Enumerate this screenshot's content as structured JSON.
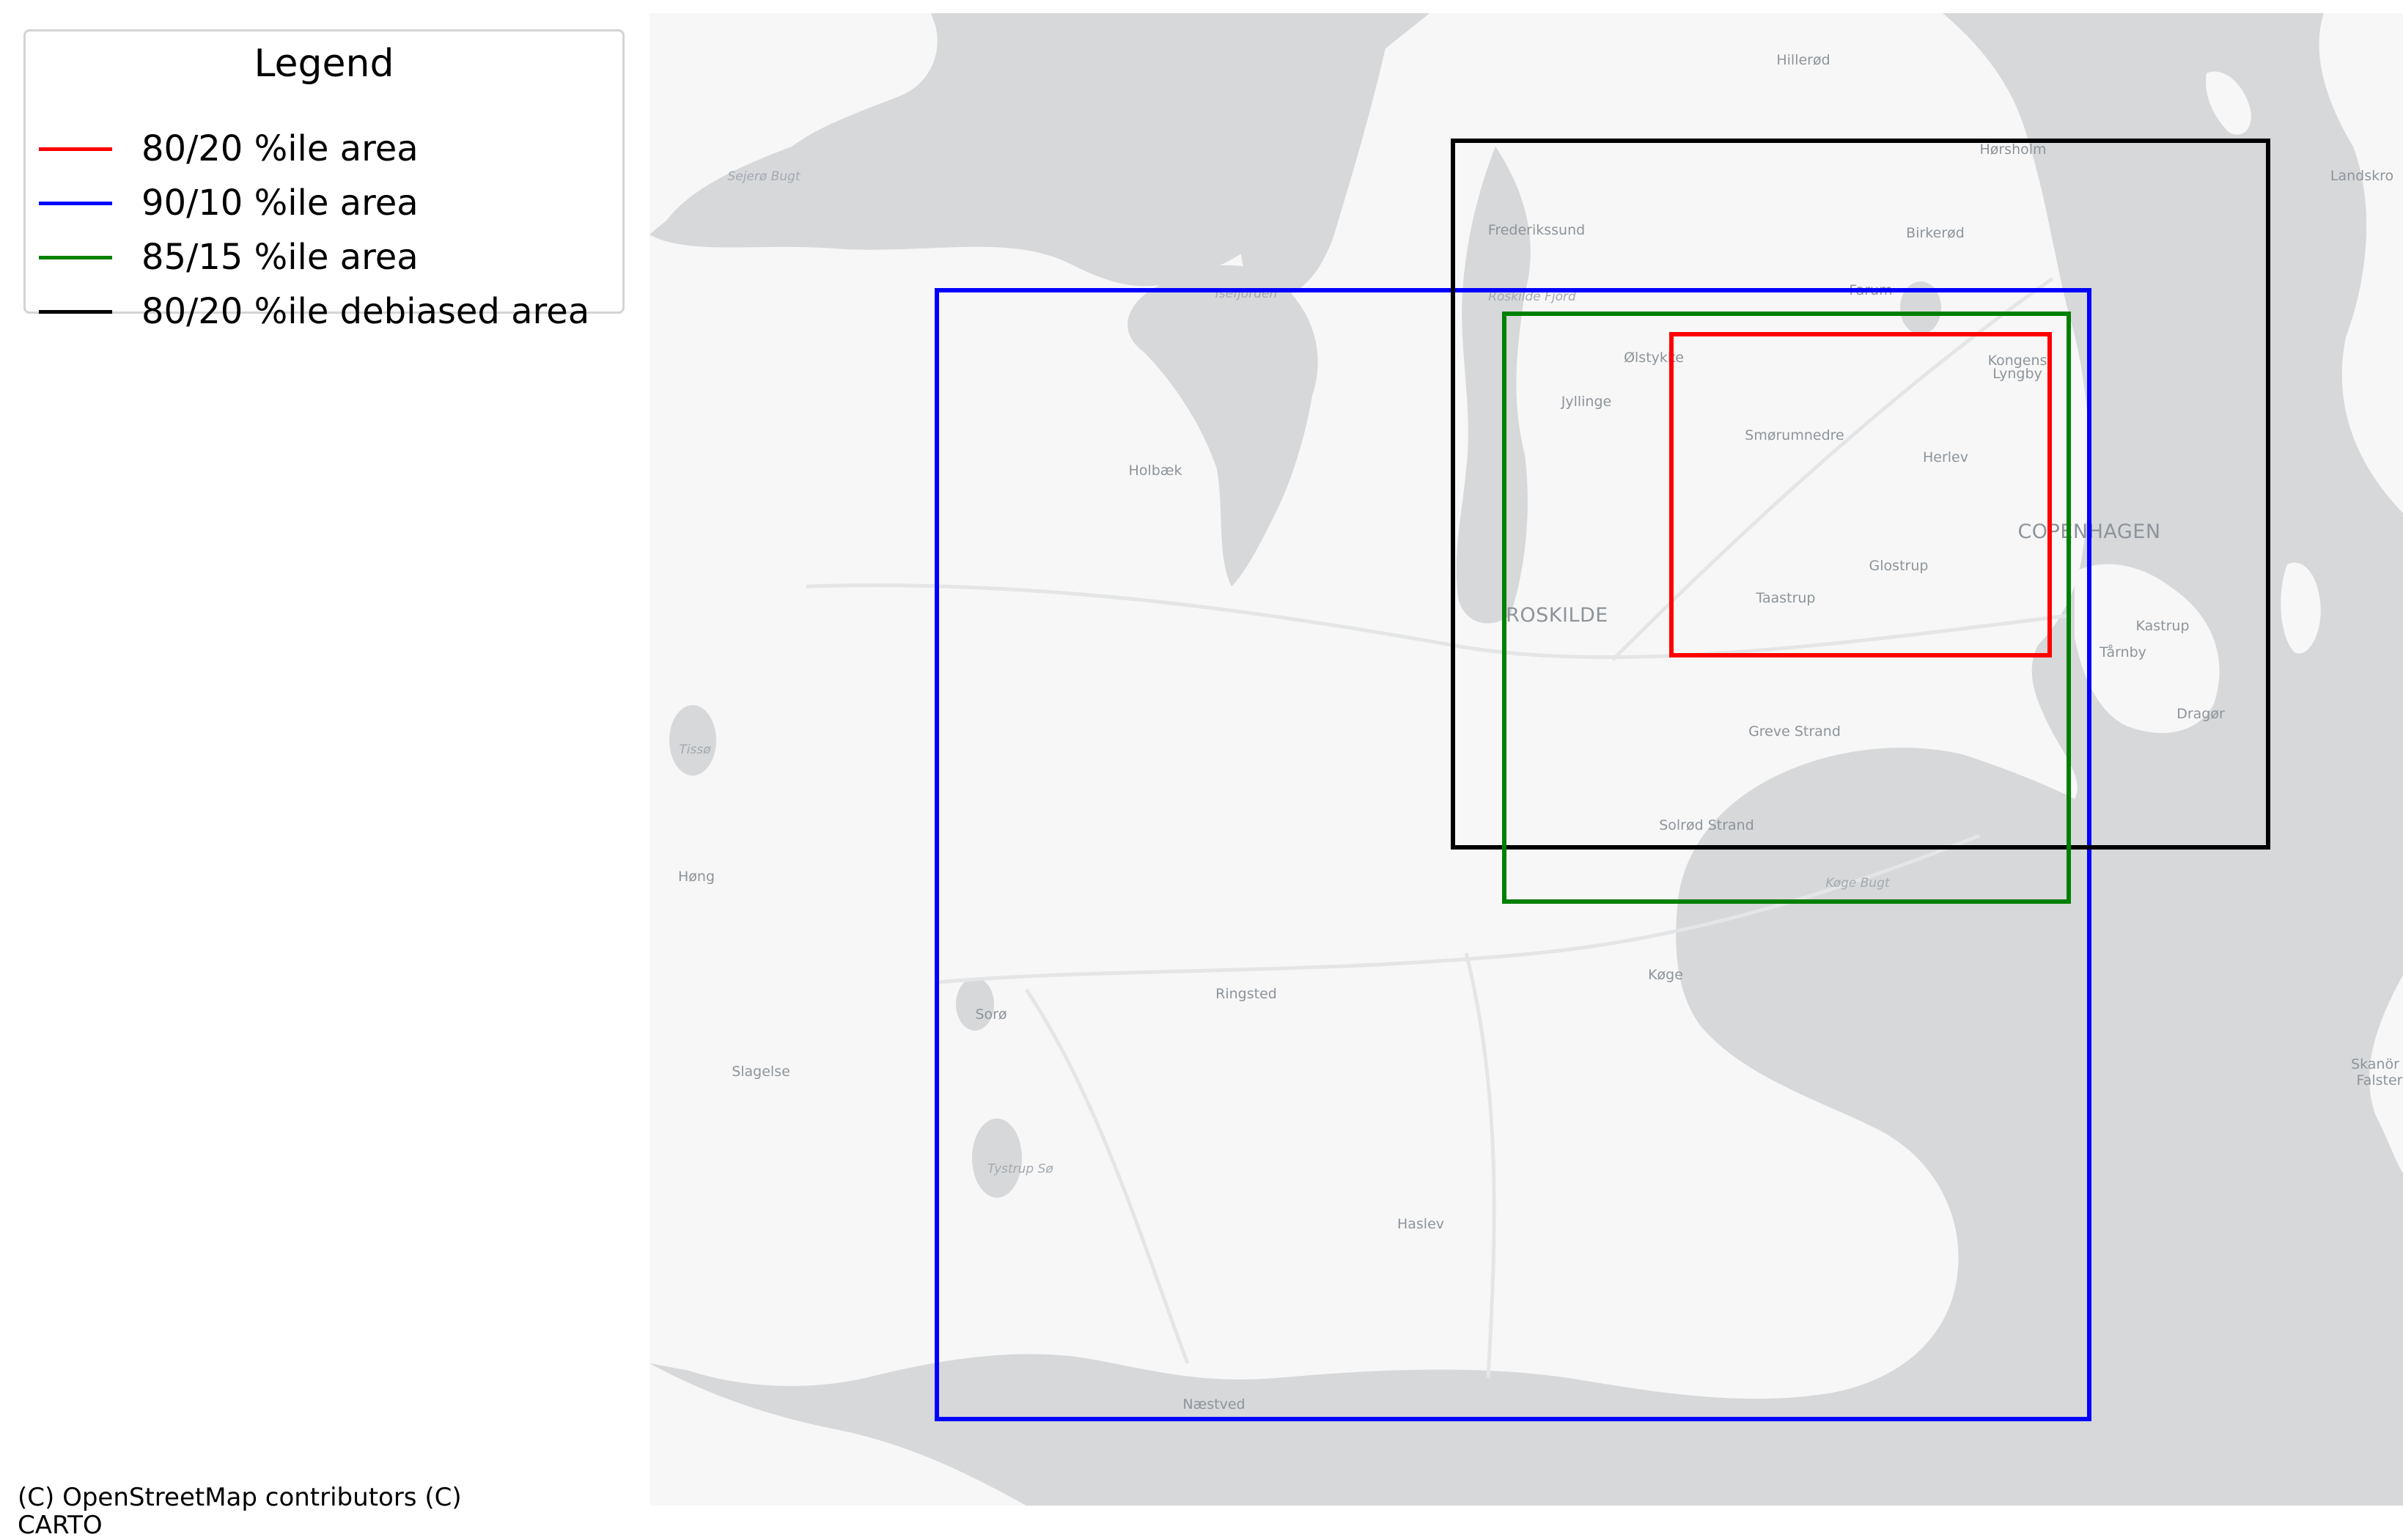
{
  "legend": {
    "title": "Legend",
    "items": [
      {
        "label": "80/20 %ile area",
        "color": "#ff0000"
      },
      {
        "label": "90/10 %ile area",
        "color": "#0000ff"
      },
      {
        "label": "85/15 %ile area",
        "color": "#008000"
      },
      {
        "label": "80/20 %ile debiased area",
        "color": "#000000"
      }
    ]
  },
  "attribution": "(C) OpenStreetMap contributors (C) CARTO",
  "basemap": {
    "land_color": "#f7f7f7",
    "water_color": "#d6d8da",
    "labels": {
      "hillerod": "Hillerød",
      "horsholm": "Hørsholm",
      "landskrona": "Landskro",
      "sejero_bugt": "Sejerø Bugt",
      "frederikssund": "Frederikssund",
      "birkerod": "Birkerød",
      "isefjorden": "Isefjorden",
      "roskilde_fjord": "Roskilde Fjord",
      "farum": "Farum",
      "olstykke": "Ølstykke",
      "kongens_lyngby_1": "Kongens",
      "kongens_lyngby_2": "Lyngby",
      "jyllinge": "Jyllinge",
      "smorumnedre": "Smørumnedre",
      "herlev": "Herlev",
      "holbaek": "Holbæk",
      "copenhagen": "COPENHAGEN",
      "glostrup": "Glostrup",
      "taastrup": "Taastrup",
      "roskilde": "ROSKILDE",
      "kastrup": "Kastrup",
      "tarnby": "Tårnby",
      "drager": "Dragør",
      "greve_strand": "Greve Strand",
      "tisso": "Tissø",
      "solrod_strand": "Solrød Strand",
      "hong": "Høng",
      "koge_bugt": "Køge Bugt",
      "koge": "Køge",
      "ringsted": "Ringsted",
      "soro": "Sorø",
      "slagelse": "Slagelse",
      "skanor_1": "Skanör",
      "skanor_2": "Falster",
      "tystrup_so": "Tystrup Sø",
      "haslev": "Haslev",
      "naestved": "Næstved"
    }
  }
}
